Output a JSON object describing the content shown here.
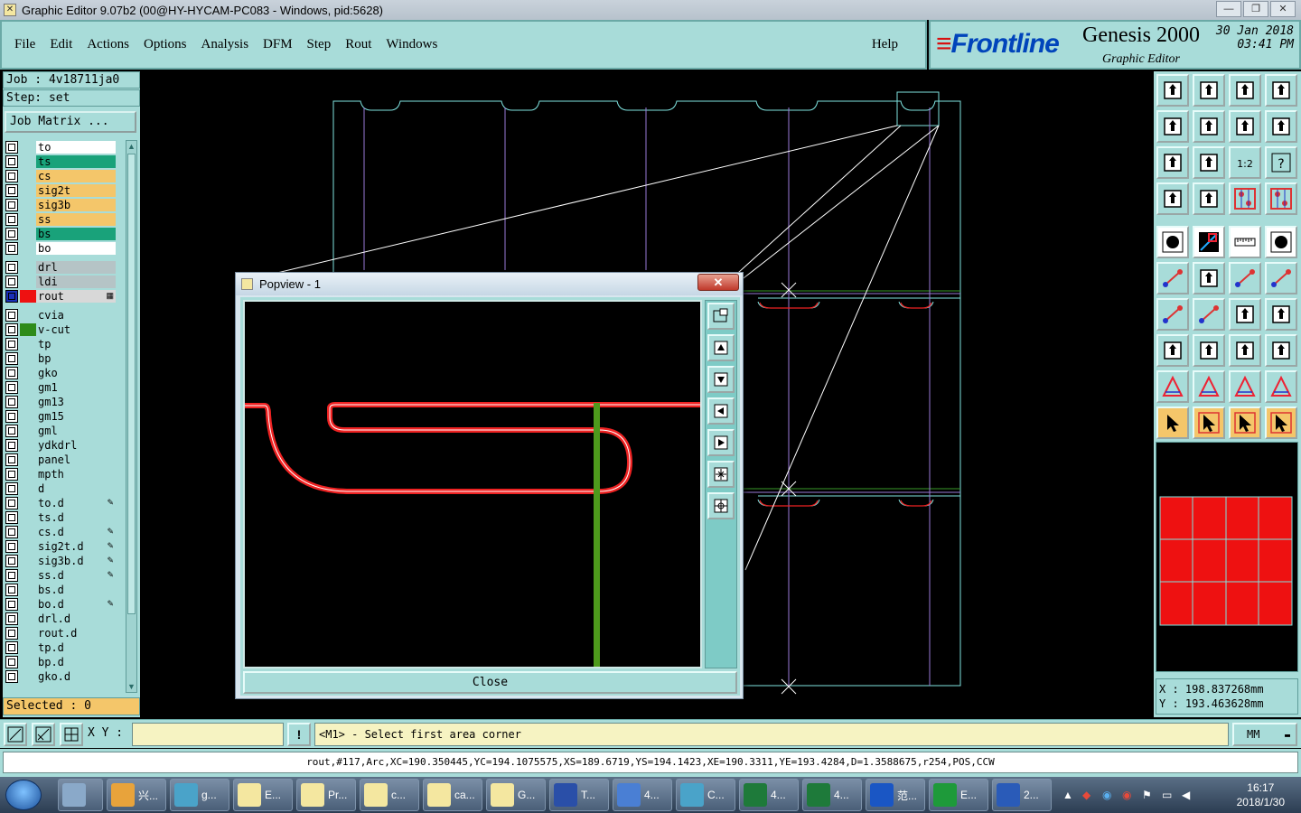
{
  "window": {
    "title": "Graphic Editor 9.07b2 (00@HY-HYCAM-PC083 - Windows, pid:5628)",
    "controls": [
      "—",
      "❐",
      "✕"
    ]
  },
  "menu": {
    "items": [
      "File",
      "Edit",
      "Actions",
      "Options",
      "Analysis",
      "DFM",
      "Step",
      "Rout",
      "Windows"
    ],
    "help": "Help"
  },
  "brand": {
    "logo": "Frontline",
    "product": "Genesis 2000",
    "subtitle": "Graphic Editor",
    "date": "30 Jan 2018",
    "time": "03:41 PM"
  },
  "job": {
    "job_label": "Job : 4v18711ja0",
    "step_label": "Step: set",
    "matrix_button": "Job Matrix ...",
    "selected": "Selected : 0"
  },
  "layers": [
    {
      "name": "to",
      "color": "#ffffff",
      "swatch": ""
    },
    {
      "name": "ts",
      "color": "#19a27a",
      "swatch": ""
    },
    {
      "name": "cs",
      "color": "#f4c66a",
      "swatch": ""
    },
    {
      "name": "sig2t",
      "color": "#f4c66a",
      "swatch": ""
    },
    {
      "name": "sig3b",
      "color": "#f4c66a",
      "swatch": ""
    },
    {
      "name": "ss",
      "color": "#f4c66a",
      "swatch": ""
    },
    {
      "name": "bs",
      "color": "#19a27a",
      "swatch": ""
    },
    {
      "name": "bo",
      "color": "#ffffff",
      "swatch": ""
    },
    {
      "name": "drl",
      "color": "#b5c4c6",
      "swatch": "",
      "gap": true
    },
    {
      "name": "ldi",
      "color": "#b5c4c6",
      "swatch": ""
    },
    {
      "name": "rout",
      "color": "#d8d8d8",
      "swatch": "#ee1111",
      "mark": "▦",
      "active": true
    },
    {
      "name": "cvia",
      "color": "#a8dcd9",
      "swatch": "",
      "gap": true
    },
    {
      "name": "v-cut",
      "color": "#a8dcd9",
      "swatch": "#2e8b1a"
    },
    {
      "name": "tp",
      "color": "#a8dcd9",
      "swatch": ""
    },
    {
      "name": "bp",
      "color": "#a8dcd9",
      "swatch": ""
    },
    {
      "name": "gko",
      "color": "#a8dcd9",
      "swatch": ""
    },
    {
      "name": "gm1",
      "color": "#a8dcd9",
      "swatch": ""
    },
    {
      "name": "gm13",
      "color": "#a8dcd9",
      "swatch": ""
    },
    {
      "name": "gm15",
      "color": "#a8dcd9",
      "swatch": ""
    },
    {
      "name": "gml",
      "color": "#a8dcd9",
      "swatch": ""
    },
    {
      "name": "ydkdrl",
      "color": "#a8dcd9",
      "swatch": ""
    },
    {
      "name": "panel",
      "color": "#a8dcd9",
      "swatch": ""
    },
    {
      "name": "mpth",
      "color": "#a8dcd9",
      "swatch": ""
    },
    {
      "name": "d",
      "color": "#a8dcd9",
      "swatch": ""
    },
    {
      "name": "to.d",
      "color": "#a8dcd9",
      "swatch": "",
      "mark": "✎"
    },
    {
      "name": "ts.d",
      "color": "#a8dcd9",
      "swatch": ""
    },
    {
      "name": "cs.d",
      "color": "#a8dcd9",
      "swatch": "",
      "mark": "✎"
    },
    {
      "name": "sig2t.d",
      "color": "#a8dcd9",
      "swatch": "",
      "mark": "✎"
    },
    {
      "name": "sig3b.d",
      "color": "#a8dcd9",
      "swatch": "",
      "mark": "✎"
    },
    {
      "name": "ss.d",
      "color": "#a8dcd9",
      "swatch": "",
      "mark": "✎"
    },
    {
      "name": "bs.d",
      "color": "#a8dcd9",
      "swatch": ""
    },
    {
      "name": "bo.d",
      "color": "#a8dcd9",
      "swatch": "",
      "mark": "✎"
    },
    {
      "name": "drl.d",
      "color": "#a8dcd9",
      "swatch": ""
    },
    {
      "name": "rout.d",
      "color": "#a8dcd9",
      "swatch": ""
    },
    {
      "name": "tp.d",
      "color": "#a8dcd9",
      "swatch": ""
    },
    {
      "name": "bp.d",
      "color": "#a8dcd9",
      "swatch": ""
    },
    {
      "name": "gko.d",
      "color": "#a8dcd9",
      "swatch": ""
    }
  ],
  "popview": {
    "title": "Popview - 1",
    "close_x": "✕",
    "close_button": "Close"
  },
  "coords": {
    "x": "X : 198.837268mm",
    "y": "Y : 193.463628mm"
  },
  "status": {
    "xy_label": "X Y :",
    "xy_value": "",
    "warn": "!",
    "prompt": "<M1> - Select first area corner",
    "units": "MM",
    "info": "rout,#117,Arc,XC=190.350445,YC=194.1075575,XS=189.6719,YS=194.1423,XE=190.3311,YE=193.4284,D=1.3588675,r254,POS,CCW"
  },
  "taskbar": {
    "items": [
      {
        "label": "",
        "icon": "calculator-icon",
        "color": "#8aa9c9"
      },
      {
        "label": "兴...",
        "icon": "shell-icon",
        "color": "#e8a33b"
      },
      {
        "label": "g...",
        "icon": "eye-icon",
        "color": "#4aa3c9"
      },
      {
        "label": "E...",
        "icon": "genesis-icon",
        "color": "#f4e7a0"
      },
      {
        "label": "Pr...",
        "icon": "genesis-icon",
        "color": "#f4e7a0"
      },
      {
        "label": "c...",
        "icon": "genesis-icon",
        "color": "#f4e7a0"
      },
      {
        "label": "ca...",
        "icon": "genesis-icon",
        "color": "#f4e7a0"
      },
      {
        "label": "G...",
        "icon": "genesis-icon",
        "color": "#f4e7a0"
      },
      {
        "label": "T...",
        "icon": "floppy-icon",
        "color": "#2a4fa8"
      },
      {
        "label": "4...",
        "icon": "document-icon",
        "color": "#4a7fd4"
      },
      {
        "label": "C...",
        "icon": "eye-icon",
        "color": "#4aa3c9"
      },
      {
        "label": "4...",
        "icon": "excel-icon",
        "color": "#1e7a3a"
      },
      {
        "label": "4...",
        "icon": "excel-icon",
        "color": "#1e7a3a"
      },
      {
        "label": "范...",
        "icon": "frontline-icon",
        "color": "#1a56c4"
      },
      {
        "label": "E...",
        "icon": "frontline-icon",
        "color": "#1e9a3a"
      },
      {
        "label": "2...",
        "icon": "word-icon",
        "color": "#2a5bb8"
      }
    ],
    "clock_time": "16:17",
    "clock_date": "2018/1/30"
  }
}
